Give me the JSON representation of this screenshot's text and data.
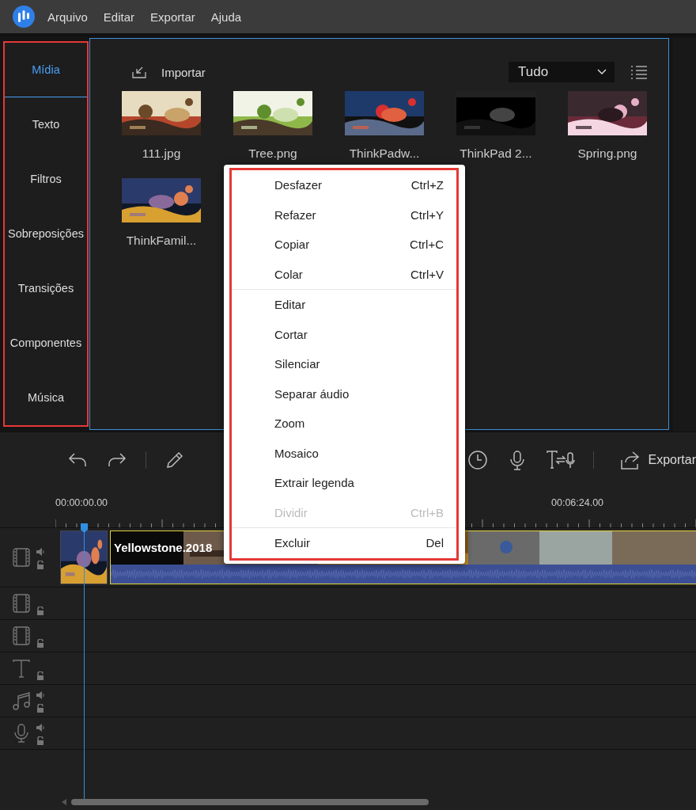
{
  "menubar": {
    "items": [
      "Arquivo",
      "Editar",
      "Exportar",
      "Ajuda"
    ]
  },
  "sidebar": {
    "items": [
      {
        "label": "Mídia",
        "selected": true
      },
      {
        "label": "Texto",
        "selected": false
      },
      {
        "label": "Filtros",
        "selected": false
      },
      {
        "label": "Sobreposições",
        "selected": false
      },
      {
        "label": "Transições",
        "selected": false
      },
      {
        "label": "Componentes",
        "selected": false
      },
      {
        "label": "Música",
        "selected": false
      }
    ]
  },
  "media": {
    "import_label": "Importar",
    "filter": "Tudo",
    "items": [
      {
        "name": "111.jpg",
        "kind": "picture"
      },
      {
        "name": "Tree.png",
        "kind": "picture"
      },
      {
        "name": "ThinkPadw...",
        "kind": "picture"
      },
      {
        "name": "ThinkPad 2...",
        "kind": "picture"
      },
      {
        "name": "Spring.png",
        "kind": "picture"
      },
      {
        "name": "ThinkFamil...",
        "kind": "picture"
      }
    ]
  },
  "context_menu": {
    "items": [
      {
        "kind": "item",
        "label": "Desfazer",
        "shortcut": "Ctrl+Z",
        "disabled": false
      },
      {
        "kind": "item",
        "label": "Refazer",
        "shortcut": "Ctrl+Y",
        "disabled": false
      },
      {
        "kind": "item",
        "label": "Copiar",
        "shortcut": "Ctrl+C",
        "disabled": false
      },
      {
        "kind": "item",
        "label": "Colar",
        "shortcut": "Ctrl+V",
        "disabled": false
      },
      {
        "kind": "separator"
      },
      {
        "kind": "item",
        "label": "Editar",
        "disabled": false
      },
      {
        "kind": "item",
        "label": "Cortar",
        "disabled": false
      },
      {
        "kind": "item",
        "label": "Silenciar",
        "disabled": false
      },
      {
        "kind": "item",
        "label": "Separar áudio",
        "disabled": false
      },
      {
        "kind": "item",
        "label": "Zoom",
        "disabled": false
      },
      {
        "kind": "item",
        "label": "Mosaico",
        "disabled": false
      },
      {
        "kind": "item",
        "label": "Extrair legenda",
        "disabled": false
      },
      {
        "kind": "item",
        "label": "Dividir",
        "shortcut": "Ctrl+B",
        "disabled": true
      },
      {
        "kind": "separator"
      },
      {
        "kind": "item",
        "label": "Excluir",
        "shortcut": "Del",
        "disabled": false
      }
    ]
  },
  "timeline": {
    "export_label": "Exportar",
    "ruler": [
      "00:00:00.00",
      "00:06:24.00"
    ],
    "tracks": [
      {
        "kind": "video",
        "volume": true,
        "clip": {
          "name": "Yellowstone.2018"
        }
      },
      {
        "kind": "video",
        "volume": false
      },
      {
        "kind": "video",
        "volume": false
      },
      {
        "kind": "text",
        "volume": false
      },
      {
        "kind": "music",
        "volume": true
      },
      {
        "kind": "voice",
        "volume": true
      }
    ]
  }
}
